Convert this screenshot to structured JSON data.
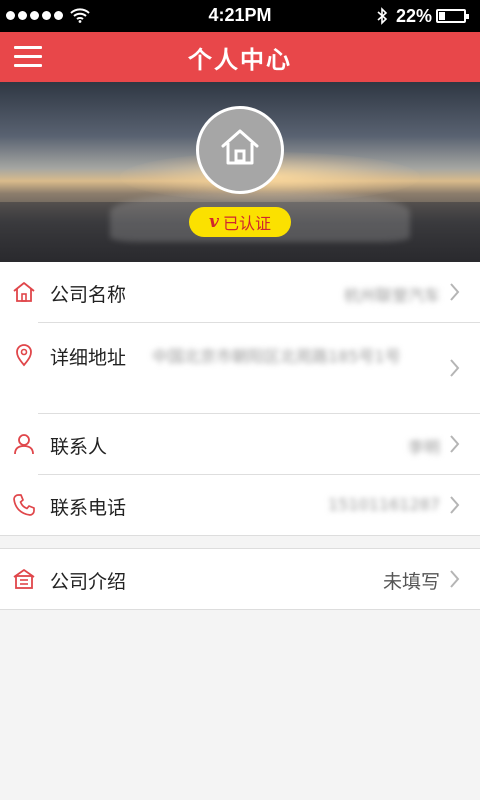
{
  "status_bar": {
    "time": "4:21PM",
    "battery": "22%",
    "battery_level": 0.22,
    "signal_bars": 5
  },
  "nav": {
    "title": "个人中心",
    "menu_icon": "hamburger-menu-icon"
  },
  "profile": {
    "avatar_icon": "house-icon",
    "badge_mark": "v",
    "badge_text": "已认证",
    "badge_color": "#fbe100"
  },
  "rows": [
    {
      "icon": "house-icon",
      "label": "公司名称",
      "value": "杭州联誉汽车",
      "blurred": true
    },
    {
      "icon": "location-pin-icon",
      "label": "详细地址",
      "value": "中国北京市朝阳区北苑路185号1号",
      "blurred": true
    },
    {
      "icon": "person-icon",
      "label": "联系人",
      "value": "李明",
      "blurred": true
    },
    {
      "icon": "phone-icon",
      "label": "联系电话",
      "value": "15101161287",
      "blurred": true
    },
    {
      "icon": "store-icon",
      "label": "公司介绍",
      "value": "未填写",
      "blurred": false
    }
  ],
  "colors": {
    "accent": "#e8474a",
    "icon_red": "#e0464a",
    "background": "#f4f4f4"
  }
}
